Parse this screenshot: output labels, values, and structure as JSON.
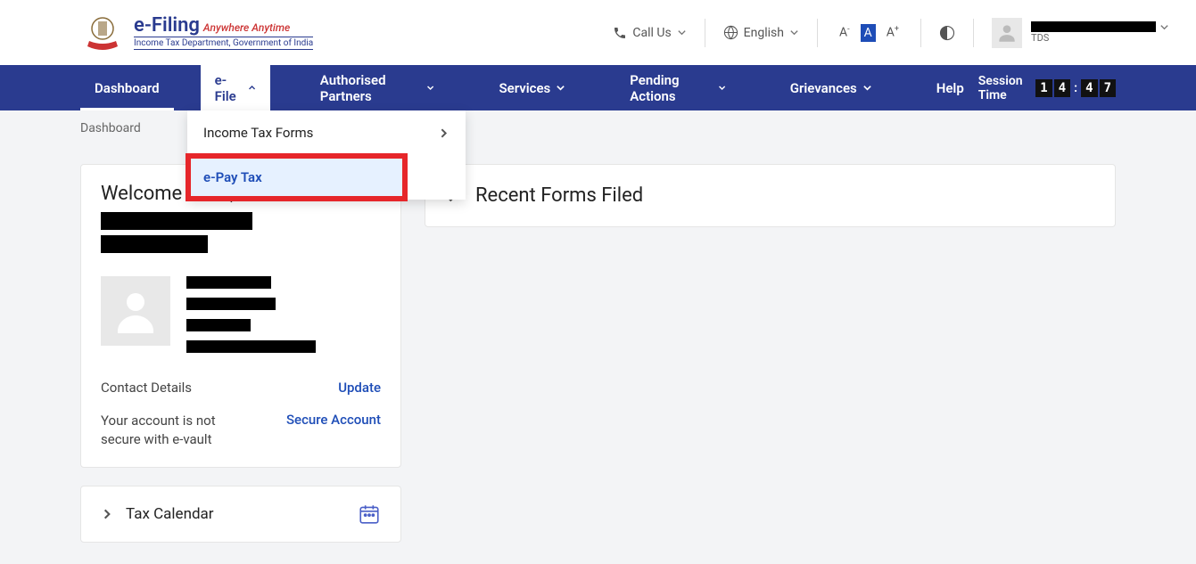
{
  "header": {
    "logo_title": "e-Filing",
    "logo_tagline": "Anywhere Anytime",
    "logo_subtitle": "Income Tax Department, Government of India",
    "call_us": "Call Us",
    "language": "English",
    "user_role": "TDS"
  },
  "nav": {
    "items": [
      "Dashboard",
      "e-File",
      "Authorised Partners",
      "Services",
      "Pending Actions",
      "Grievances",
      "Help"
    ],
    "session_label": "Session Time",
    "session_digits": [
      "1",
      "4",
      "4",
      "7"
    ]
  },
  "dropdown": {
    "items": [
      {
        "label": "Income Tax Forms",
        "has_sub": true,
        "highlighted": false
      },
      {
        "label": "e-Pay Tax",
        "has_sub": false,
        "highlighted": true
      }
    ]
  },
  "breadcrumb": "Dashboard",
  "welcome": {
    "greeting": "Welcome Back,",
    "contact_label": "Contact Details",
    "update": "Update",
    "secure_msg": "Your account is not secure with e-vault",
    "secure_link": "Secure Account"
  },
  "tax_calendar": "Tax Calendar",
  "recent_forms": "Recent Forms Filed"
}
